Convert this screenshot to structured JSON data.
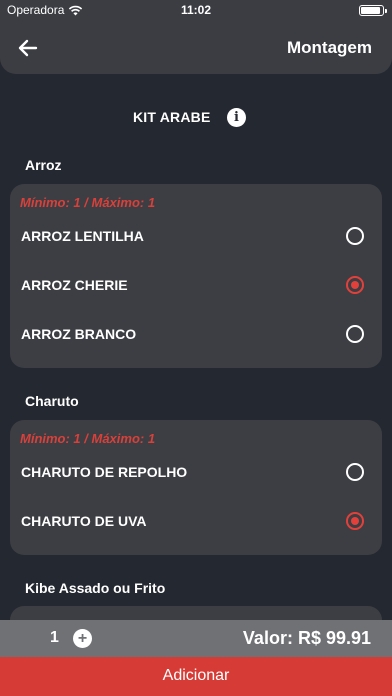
{
  "status_bar": {
    "carrier": "Operadora",
    "time": "11:02"
  },
  "nav": {
    "title": "Montagem",
    "back_icon": "arrow-left-icon"
  },
  "kit": {
    "title": "KIT ARABE",
    "info_icon": "info-icon"
  },
  "groups": [
    {
      "label": "Arroz",
      "limits": "Mínimo: 1 / Máximo: 1",
      "options": [
        {
          "label": "ARROZ LENTILHA",
          "selected": false
        },
        {
          "label": "ARROZ CHERIE",
          "selected": true
        },
        {
          "label": "ARROZ BRANCO",
          "selected": false
        }
      ]
    },
    {
      "label": "Charuto",
      "limits": "Mínimo: 1 / Máximo: 1",
      "options": [
        {
          "label": "CHARUTO DE REPOLHO",
          "selected": false
        },
        {
          "label": "CHARUTO DE UVA",
          "selected": true
        }
      ]
    },
    {
      "label": "Kibe Assado ou Frito"
    }
  ],
  "footer": {
    "quantity": "1",
    "plus_icon": "plus-icon",
    "total": "Valor: R$ 99.91",
    "add_label": "Adicionar"
  },
  "colors": {
    "accent": "#d73b35",
    "background": "#242830",
    "card": "#3c3e43"
  }
}
